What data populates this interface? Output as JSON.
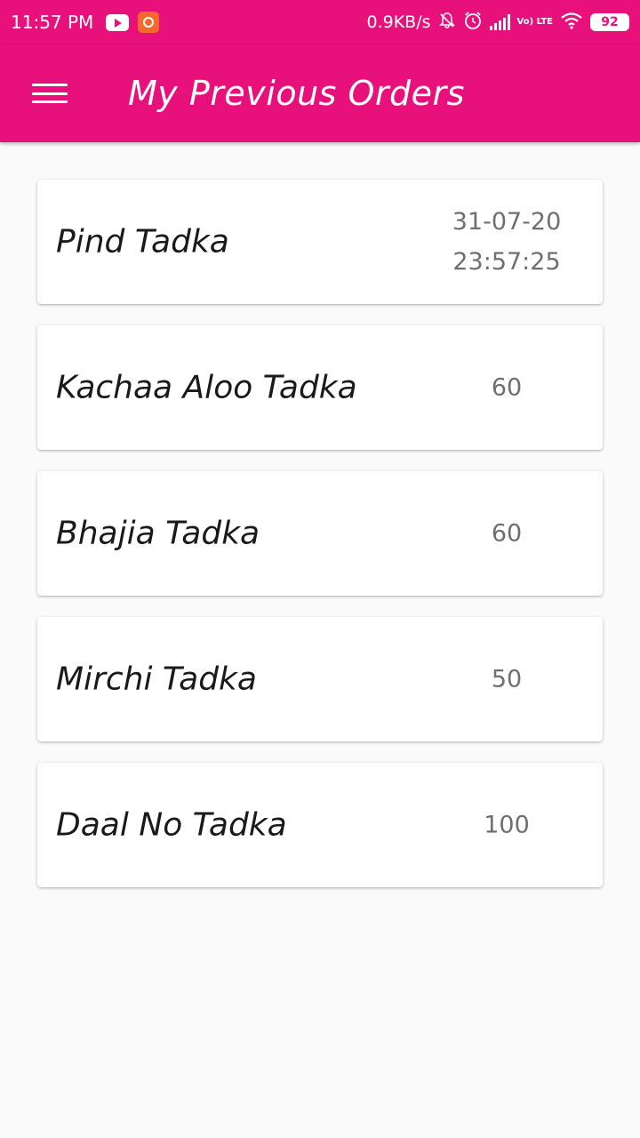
{
  "status_bar": {
    "time": "11:57 PM",
    "speed": "0.9KB/s",
    "volte": "Vo) LTE",
    "battery": "92"
  },
  "app_bar": {
    "title": "My Previous Orders"
  },
  "orders": [
    {
      "name": "Pind Tadka",
      "value_line1": "31-07-20",
      "value_line2": "23:57:25"
    },
    {
      "name": "Kachaa Aloo Tadka",
      "value_line1": "60",
      "value_line2": ""
    },
    {
      "name": "Bhajia Tadka",
      "value_line1": "60",
      "value_line2": ""
    },
    {
      "name": "Mirchi Tadka",
      "value_line1": "50",
      "value_line2": ""
    },
    {
      "name": "Daal No Tadka",
      "value_line1": "100",
      "value_line2": ""
    }
  ],
  "colors": {
    "primary": "#e8107a",
    "background": "#fafafa",
    "card": "#ffffff",
    "secondary_text": "#6f6f6f"
  },
  "icons": [
    "menu-icon",
    "youtube-icon",
    "screen-recorder-icon",
    "mute-bell-icon",
    "alarm-icon",
    "signal-icon",
    "wifi-icon",
    "battery-icon"
  ]
}
